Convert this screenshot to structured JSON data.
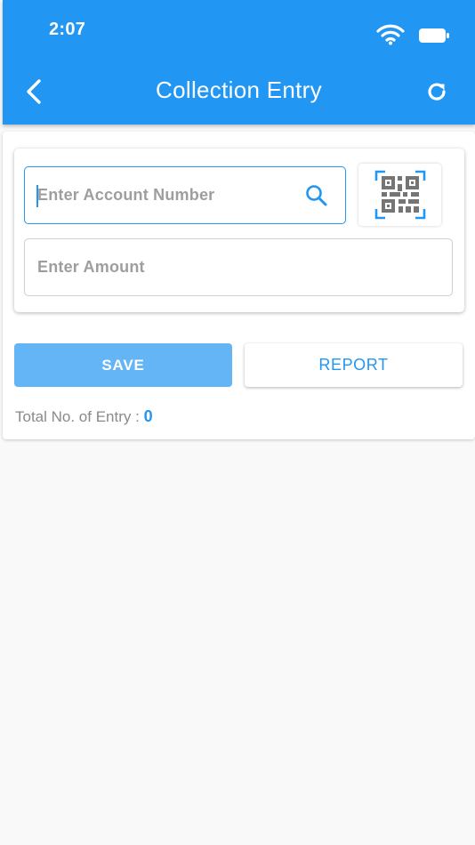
{
  "status_bar": {
    "time": "2:07"
  },
  "header": {
    "title": "Collection Entry",
    "back_icon": "chevron-left-icon",
    "refresh_icon": "refresh-icon",
    "background": "#2196f3"
  },
  "form": {
    "account_placeholder": "Enter Account Number",
    "account_value": "",
    "search_icon": "search-icon",
    "qr_icon": "qr-scan-icon",
    "amount_placeholder": "Enter Amount",
    "amount_value": ""
  },
  "actions": {
    "save_label": "SAVE",
    "report_label": "REPORT"
  },
  "summary": {
    "total_label": "Total No. of Entry : ",
    "total_value": "0"
  },
  "colors": {
    "accent": "#2196f3",
    "save_button": "#64b5f6",
    "placeholder": "#9e9e9e"
  }
}
